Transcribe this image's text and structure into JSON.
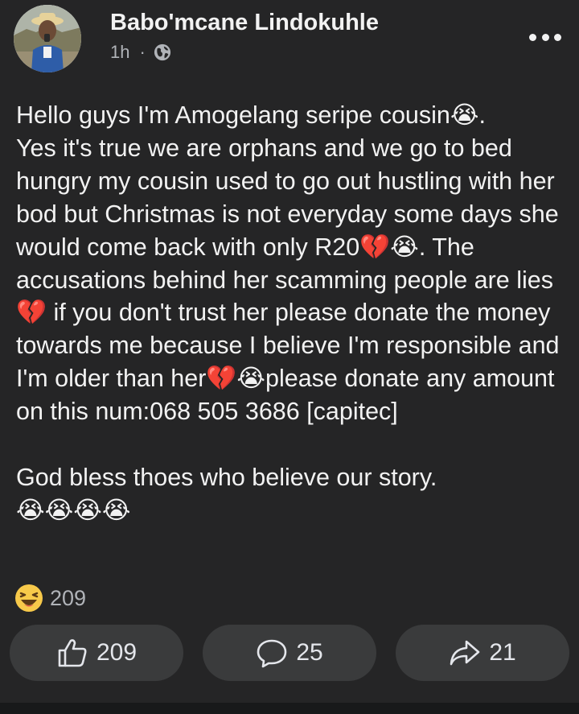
{
  "post": {
    "author": "Babo'mcane Lindokuhle",
    "time": "1h",
    "separator": "·",
    "privacy_icon": "globe-icon",
    "more_icon": "more-dots-icon",
    "body": "Hello guys I'm Amogelang seripe cousin😭.\nYes it's true we are orphans and we go to bed hungry my cousin used to go out hustling with her bod but Christmas is not everyday some days she would come back with only R20💔😭. The accusations behind her scamming people are lies💔 if you don't trust her please donate the money towards me because I believe I'm responsible and I'm older than her💔😭please donate any amount on this num:068 505 3686 [capitec]\n\nGod bless thoes who believe our story.\n😭😭😭😭",
    "reactions": {
      "icon": "haha-emoji-icon",
      "count": "209"
    }
  },
  "actions": {
    "like": {
      "icon": "thumbs-up-icon",
      "count": "209"
    },
    "comment": {
      "icon": "comment-bubble-icon",
      "count": "25"
    },
    "share": {
      "icon": "share-arrow-icon",
      "count": "21"
    }
  },
  "colors": {
    "background": "#252526",
    "button_background": "#3a3b3c",
    "text_primary": "#f2f2f2",
    "text_secondary": "#b0b3b8"
  }
}
